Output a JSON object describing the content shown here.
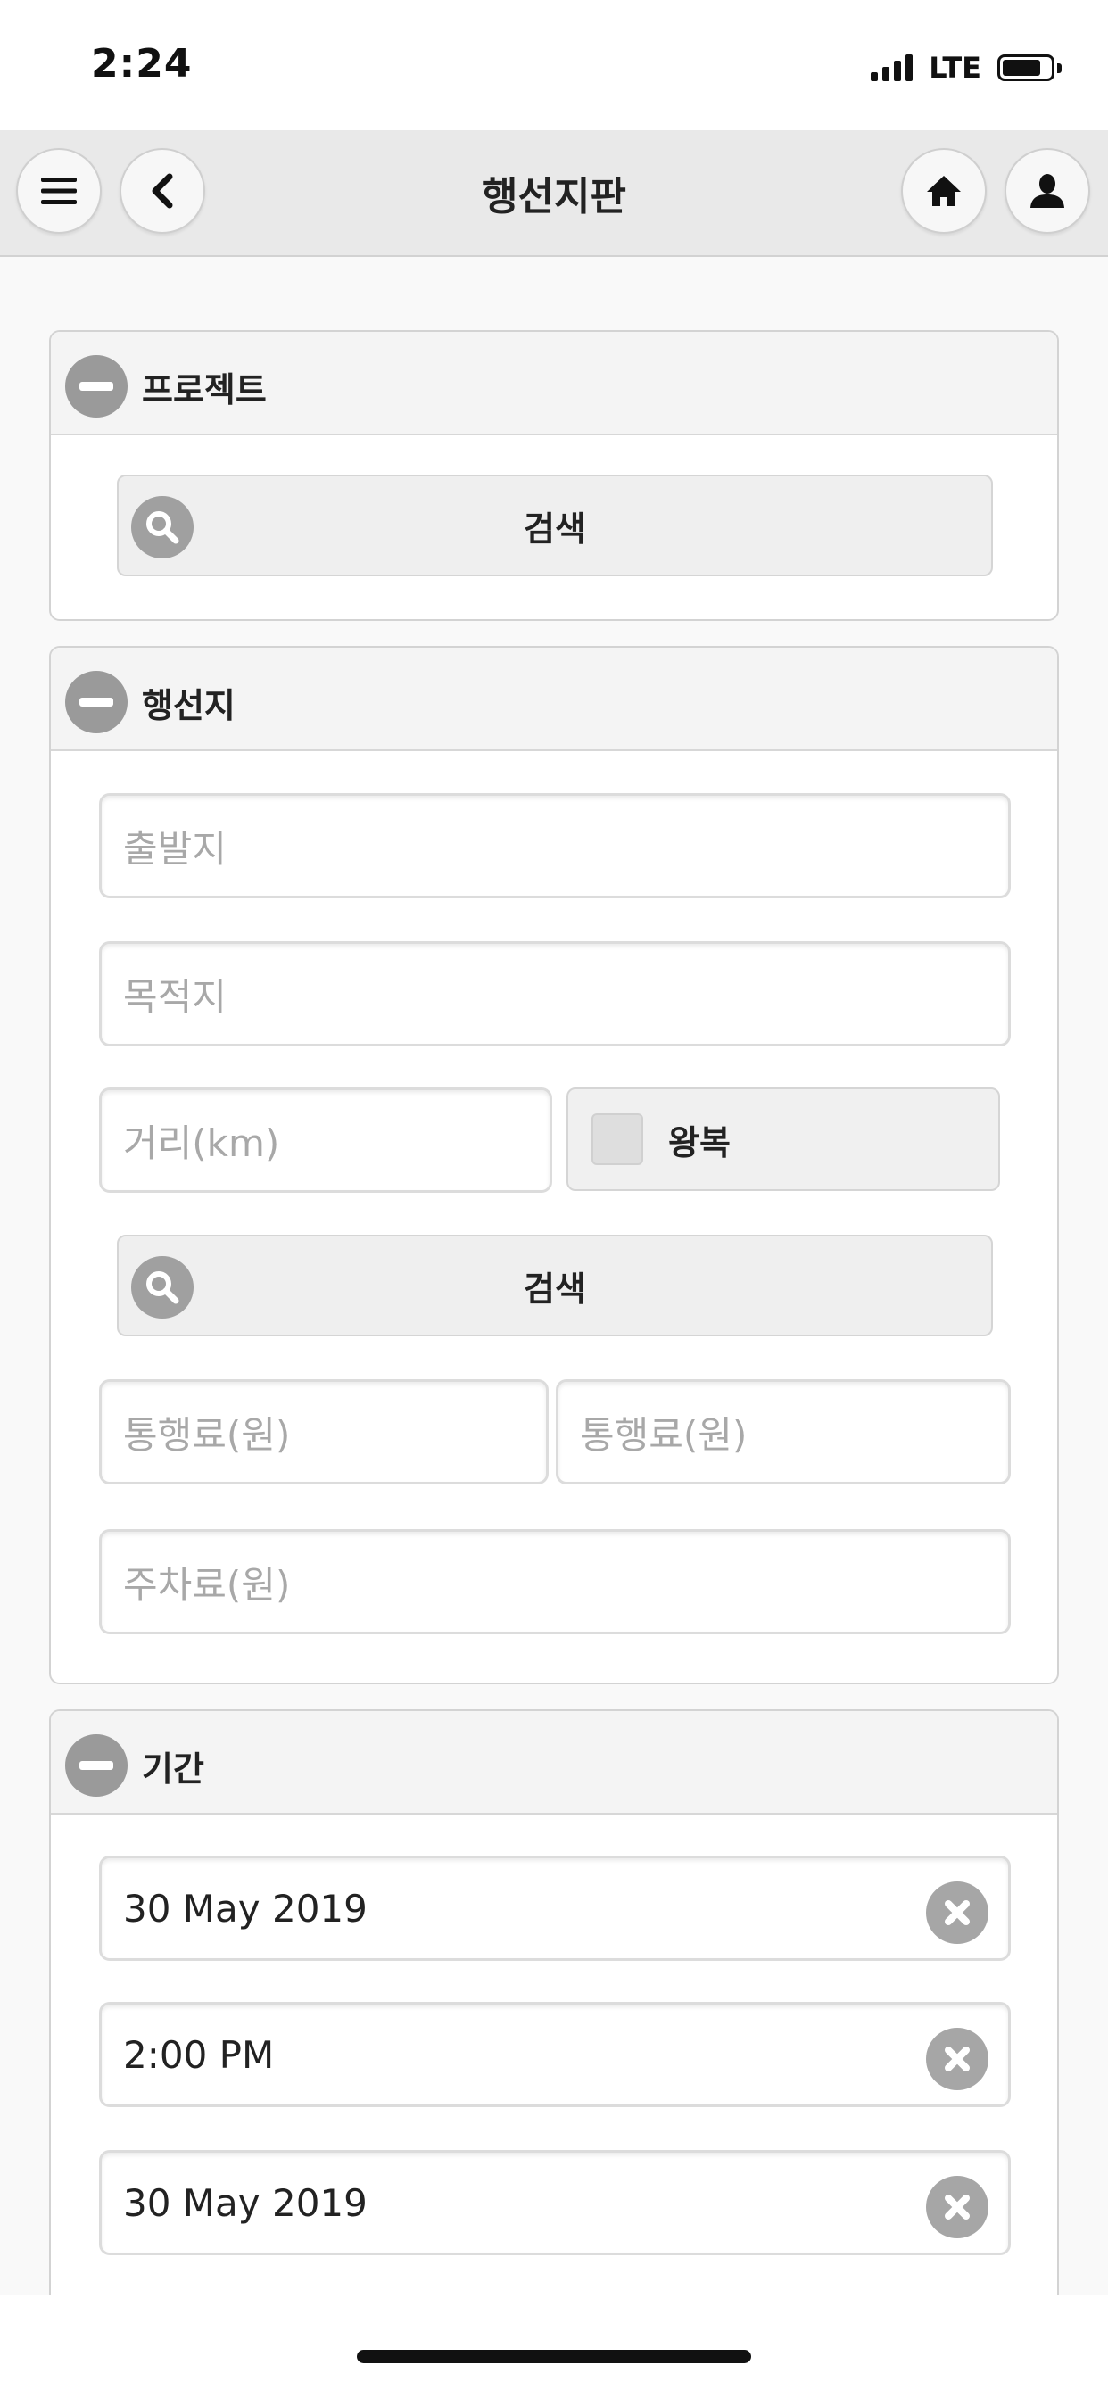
{
  "status_bar": {
    "time": "2:24",
    "network": "LTE"
  },
  "header": {
    "title": "행선지판"
  },
  "sections": {
    "project": {
      "title": "프로젝트",
      "search_label": "검색"
    },
    "destination": {
      "title": "행선지",
      "origin_placeholder": "출발지",
      "destination_placeholder": "목적지",
      "distance_placeholder": "거리(km)",
      "round_trip_label": "왕복",
      "round_trip_checked": false,
      "search_label": "검색",
      "toll_placeholder_1": "통행료(원)",
      "toll_placeholder_2": "통행료(원)",
      "parking_placeholder": "주차료(원)"
    },
    "period": {
      "title": "기간",
      "start_date": "30 May 2019",
      "start_time": "2:00 PM",
      "end_date": "30 May 2019"
    }
  },
  "colors": {
    "icon_gray": "#9a9a9a",
    "header_bg": "#e9e9e9",
    "panel_head_bg": "#f4f4f4"
  }
}
